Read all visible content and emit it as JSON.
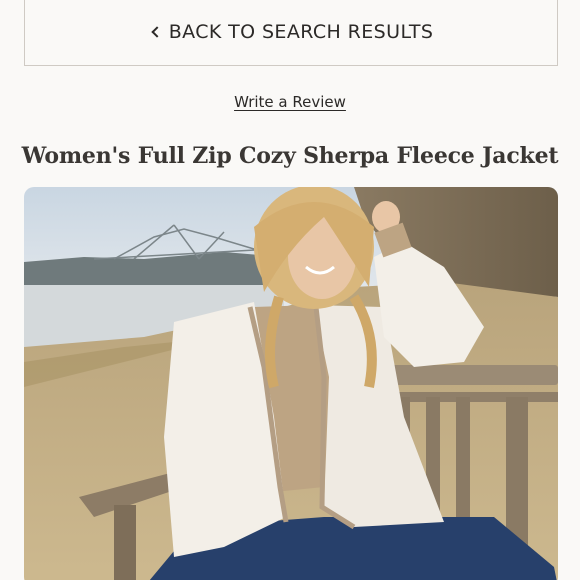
{
  "nav": {
    "back_label": "BACK TO SEARCH RESULTS",
    "back_icon": "chevron-left-icon"
  },
  "review": {
    "link_label": "Write a Review"
  },
  "product": {
    "title": "Women's Full Zip Cozy Sherpa Fleece Jacket"
  },
  "colors": {
    "page_background": "#faf9f7",
    "border": "#cfcac4",
    "text": "#2c2a28",
    "jacket": "#f3efe8",
    "trim": "#b49e84"
  }
}
